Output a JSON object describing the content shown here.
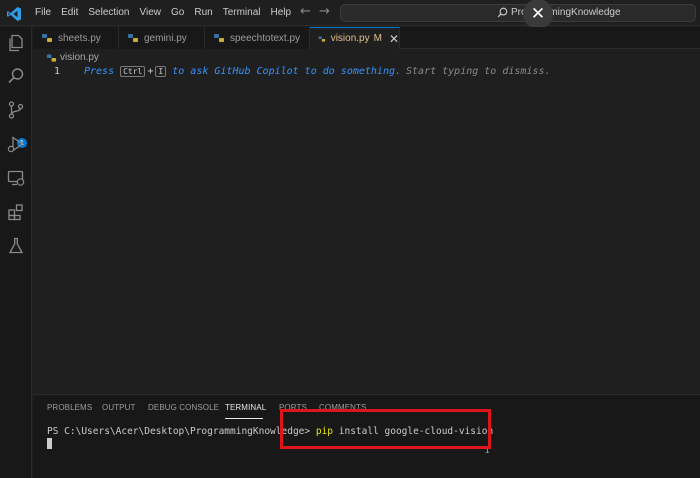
{
  "menu": [
    "File",
    "Edit",
    "Selection",
    "View",
    "Go",
    "Run",
    "Terminal",
    "Help"
  ],
  "search": {
    "text": "ProgrammingKnowledge"
  },
  "activity": {
    "source_control_badge": "1"
  },
  "tabs": [
    {
      "label": "sheets.py",
      "modified": false
    },
    {
      "label": "gemini.py",
      "modified": false
    },
    {
      "label": "speechtotext.py",
      "modified": false
    },
    {
      "label": "vision.py",
      "modified": true,
      "status": "M",
      "active": true
    }
  ],
  "breadcrumb": "vision.py",
  "editor": {
    "line_number": "1",
    "hint": {
      "press": "Press",
      "key1": "Ctrl",
      "plus": "+",
      "key2": "I",
      "rest": "to ask GitHub Copilot to do something.",
      "dismiss": "Start typing to dismiss."
    }
  },
  "panel": {
    "tabs": [
      "PROBLEMS",
      "OUTPUT",
      "DEBUG CONSOLE",
      "TERMINAL",
      "PORTS",
      "COMMENTS"
    ],
    "active_tab": "TERMINAL",
    "terminal": {
      "prompt": "PS C:\\Users\\Acer\\Desktop\\ProgrammingKnowledge>",
      "command": "pip",
      "args": "install google-cloud-vision"
    }
  },
  "colors": {
    "accent": "#0078d4",
    "annotation_box": "#e0141b",
    "hint_text": "#3794ff",
    "command": "#e5e510"
  }
}
